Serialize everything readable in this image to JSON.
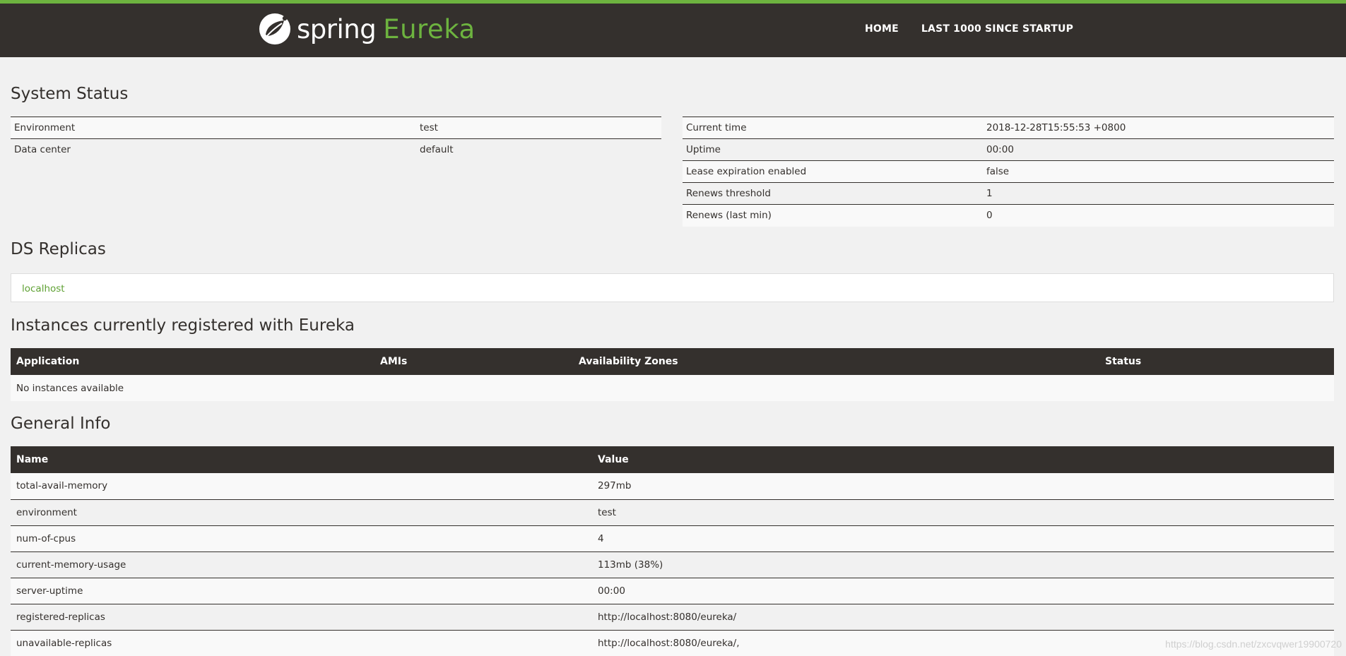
{
  "brand": {
    "name_part1": "spring",
    "name_part2": "Eureka",
    "accent_color": "#6db33f",
    "logo_icon": "spring-leaf-icon"
  },
  "nav": {
    "home": "HOME",
    "last1000": "LAST 1000 SINCE STARTUP"
  },
  "system_status": {
    "title": "System Status",
    "left": [
      {
        "label": "Environment",
        "value": "test"
      },
      {
        "label": "Data center",
        "value": "default"
      }
    ],
    "right": [
      {
        "label": "Current time",
        "value": "2018-12-28T15:55:53 +0800"
      },
      {
        "label": "Uptime",
        "value": "00:00"
      },
      {
        "label": "Lease expiration enabled",
        "value": "false"
      },
      {
        "label": "Renews threshold",
        "value": "1"
      },
      {
        "label": "Renews (last min)",
        "value": "0"
      }
    ]
  },
  "ds_replicas": {
    "title": "DS Replicas",
    "items": [
      "localhost"
    ]
  },
  "instances": {
    "title": "Instances currently registered with Eureka",
    "headers": [
      "Application",
      "AMIs",
      "Availability Zones",
      "Status"
    ],
    "empty_message": "No instances available"
  },
  "general_info": {
    "title": "General Info",
    "headers": [
      "Name",
      "Value"
    ],
    "rows": [
      {
        "name": "total-avail-memory",
        "value": "297mb"
      },
      {
        "name": "environment",
        "value": "test"
      },
      {
        "name": "num-of-cpus",
        "value": "4"
      },
      {
        "name": "current-memory-usage",
        "value": "113mb (38%)"
      },
      {
        "name": "server-uptime",
        "value": "00:00"
      },
      {
        "name": "registered-replicas",
        "value": "http://localhost:8080/eureka/"
      },
      {
        "name": "unavailable-replicas",
        "value": "http://localhost:8080/eureka/,"
      }
    ]
  },
  "watermark": "https://blog.csdn.net/zxcvqwer19900720"
}
